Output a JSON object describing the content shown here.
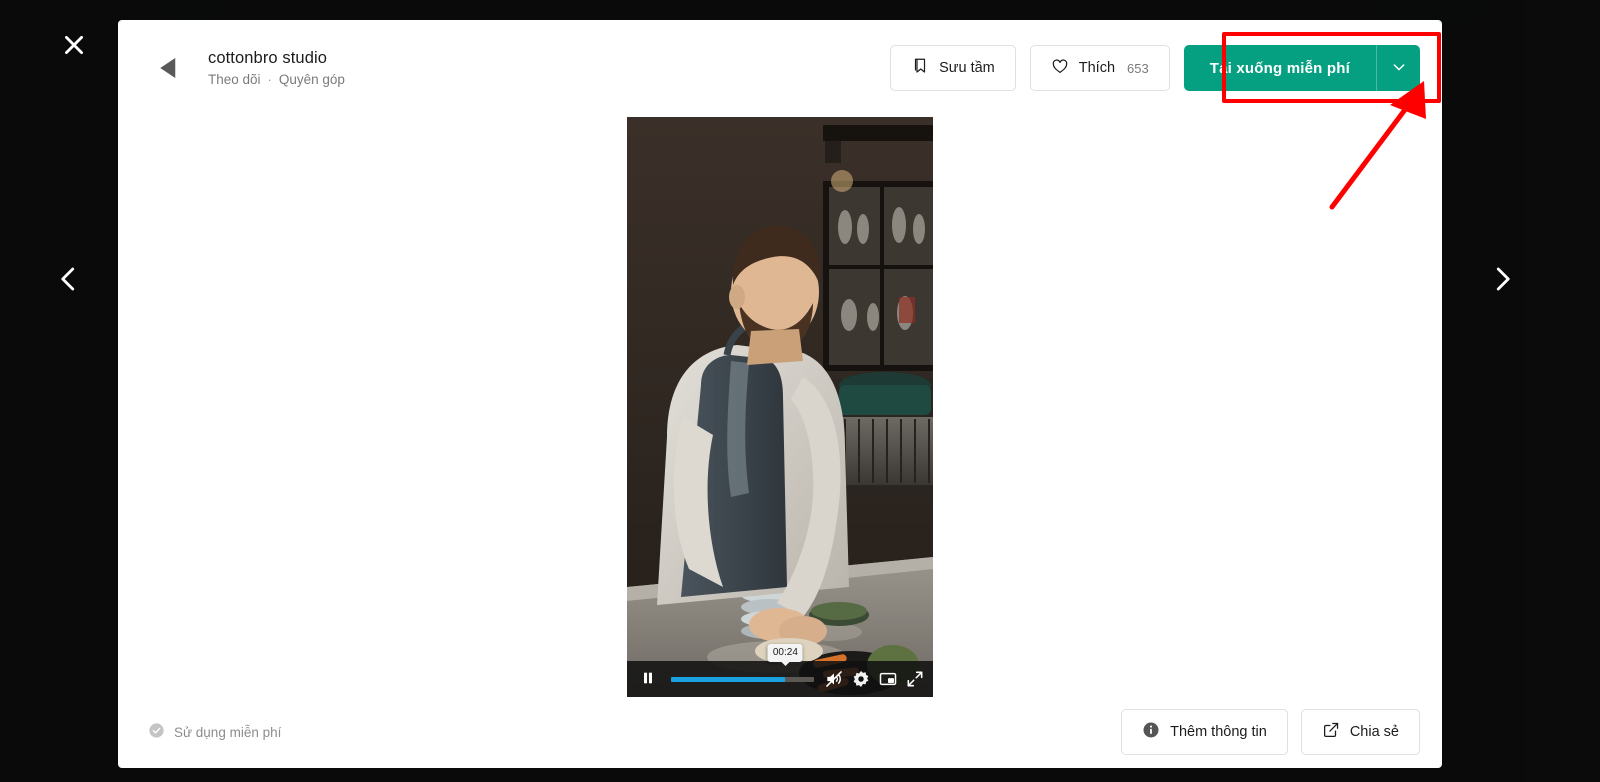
{
  "page": {
    "background_color": "#161616",
    "modal_background": "#ffffff",
    "accent_green": "#05a081",
    "annotation_color": "#ff0000"
  },
  "overlay": {
    "close_label": "close-icon",
    "prev_label": "chevron-left-icon",
    "next_label": "chevron-right-icon"
  },
  "header": {
    "author_name": "cottonbro studio",
    "follow_label": "Theo dõi",
    "separator": "·",
    "donate_label": "Quyên góp",
    "collect_label": "Sưu tầm",
    "like_label": "Thích",
    "like_count": "653",
    "download_label": "Tải xuống miễn phí",
    "download_chevron": "chevron-down-icon"
  },
  "player": {
    "state": "playing",
    "pause_label": "pause-icon",
    "time_tooltip": "00:24",
    "progress_percent": 80,
    "progress_color": "#19a1e0",
    "mute_label": "muted-volume-icon",
    "settings_label": "gear-icon",
    "pip_label": "picture-in-picture-icon",
    "fullscreen_label": "fullscreen-icon"
  },
  "footer": {
    "free_use_label": "Sử dụng miễn phí",
    "more_info_label": "Thêm thông tin",
    "share_label": "Chia sẻ"
  }
}
